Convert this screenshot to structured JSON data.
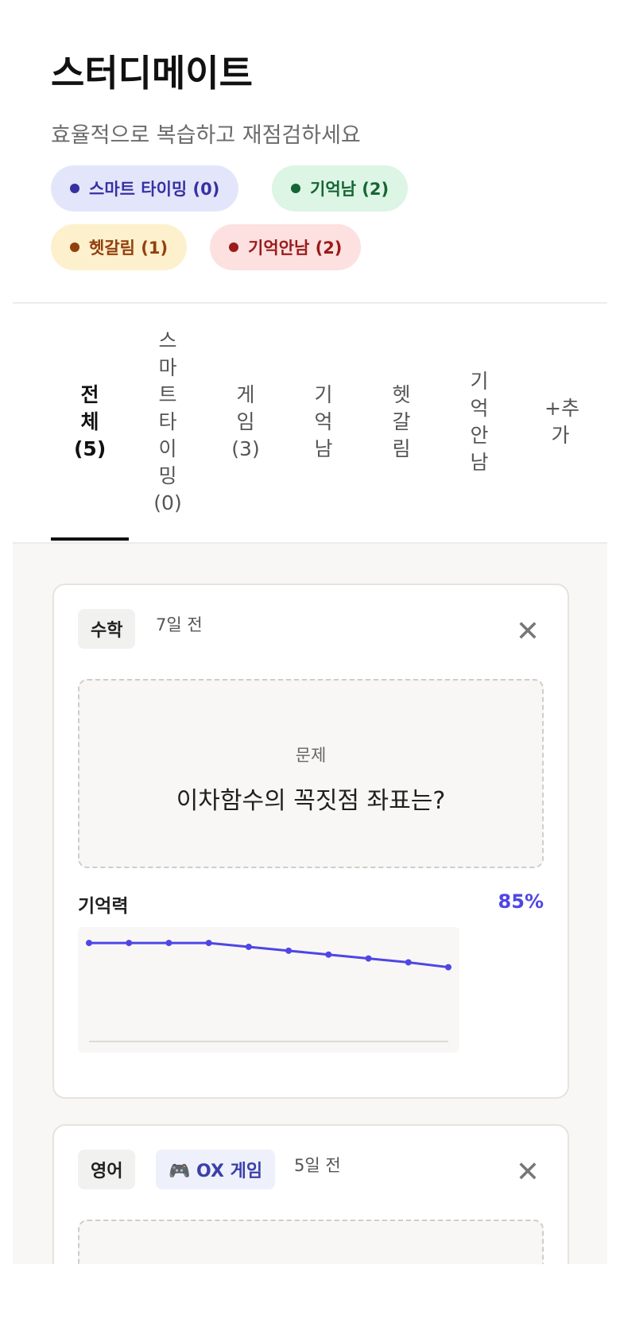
{
  "app": {
    "title": "스터디메이트",
    "subtitle": "효율적으로 복습하고 재점검하세요"
  },
  "status_chips": [
    {
      "label": "스마트 타이밍 (0)",
      "color": "#3730a3"
    },
    {
      "label": "기억남 (2)",
      "color": "#166534"
    },
    {
      "label": "헷갈림 (1)",
      "color": "#92400e"
    },
    {
      "label": "기억안남 (2)",
      "color": "#991b1b"
    }
  ],
  "tabs": [
    {
      "label": "전체",
      "count": "(5)",
      "active": true
    },
    {
      "label": "스마트타이밍",
      "count": "(0)",
      "active": false
    },
    {
      "label": "게임",
      "count": "(3)",
      "active": false
    },
    {
      "label": "기억남",
      "count": "",
      "active": false
    },
    {
      "label": "헷갈림",
      "count": "",
      "active": false
    },
    {
      "label": "기억안남",
      "count": "",
      "active": false
    },
    {
      "label": "+추가",
      "count": "",
      "active": false
    }
  ],
  "cards": [
    {
      "subject": "수학",
      "time_ago": "7일 전",
      "close_icon": "close-icon",
      "question_label": "문제",
      "question": "이차함수의 꼭짓점 좌표는?",
      "memory_label": "기억력",
      "memory_value": "85%",
      "accent_color": "#4f46e5"
    },
    {
      "subject": "영어",
      "game_tag": "🎮 OX 게임",
      "time_ago": "5일 전",
      "close_icon": "close-icon"
    }
  ],
  "chart_data": {
    "type": "line",
    "x": [
      1,
      2,
      3,
      4,
      5,
      6,
      7,
      8,
      9,
      10
    ],
    "series": [
      {
        "values": [
          100,
          100,
          100,
          100,
          96,
          92,
          88,
          84,
          80,
          75
        ]
      }
    ],
    "ylim": [
      0,
      105
    ],
    "grid": false,
    "color": "#4f46e5"
  }
}
